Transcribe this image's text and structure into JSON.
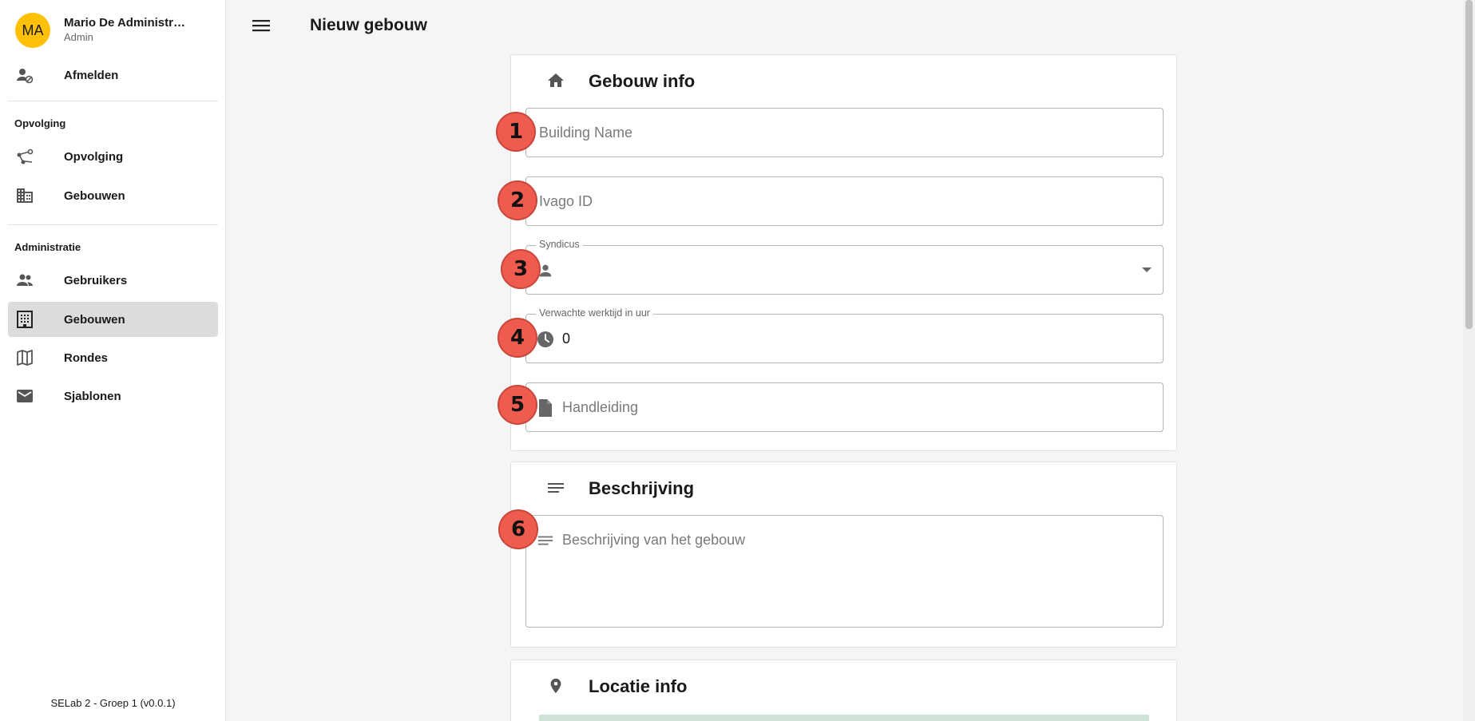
{
  "user": {
    "initials": "MA",
    "name": "Mario De Administrat...",
    "role": "Admin"
  },
  "sidebar": {
    "logout_label": "Afmelden",
    "sections": [
      {
        "title": "Opvolging",
        "items": [
          {
            "label": "Opvolging",
            "icon": "route-icon"
          },
          {
            "label": "Gebouwen",
            "icon": "building-icon"
          }
        ]
      },
      {
        "title": "Administratie",
        "items": [
          {
            "label": "Gebruikers",
            "icon": "users-icon"
          },
          {
            "label": "Gebouwen",
            "icon": "apartment-icon",
            "active": true
          },
          {
            "label": "Rondes",
            "icon": "map-icon"
          },
          {
            "label": "Sjablonen",
            "icon": "mail-icon"
          }
        ]
      }
    ],
    "footer": "SELab 2 - Groep 1 (v0.0.1)"
  },
  "header": {
    "title": "Nieuw gebouw"
  },
  "building_info": {
    "title": "Gebouw info",
    "name_placeholder": "Building Name",
    "ivago_placeholder": "Ivago ID",
    "syndicus_label": "Syndicus",
    "syndicus_value": "",
    "worktime_label": "Verwachte werktijd in uur",
    "worktime_value": "0",
    "manual_placeholder": "Handleiding"
  },
  "description": {
    "title": "Beschrijving",
    "placeholder": "Beschrijving van het gebouw"
  },
  "location": {
    "title": "Locatie info"
  },
  "badges": [
    "1",
    "2",
    "3",
    "4",
    "5",
    "6"
  ],
  "colors": {
    "avatar": "#ffc107",
    "badge": "#ef5b4f",
    "active_nav": "#dcdcdc"
  }
}
